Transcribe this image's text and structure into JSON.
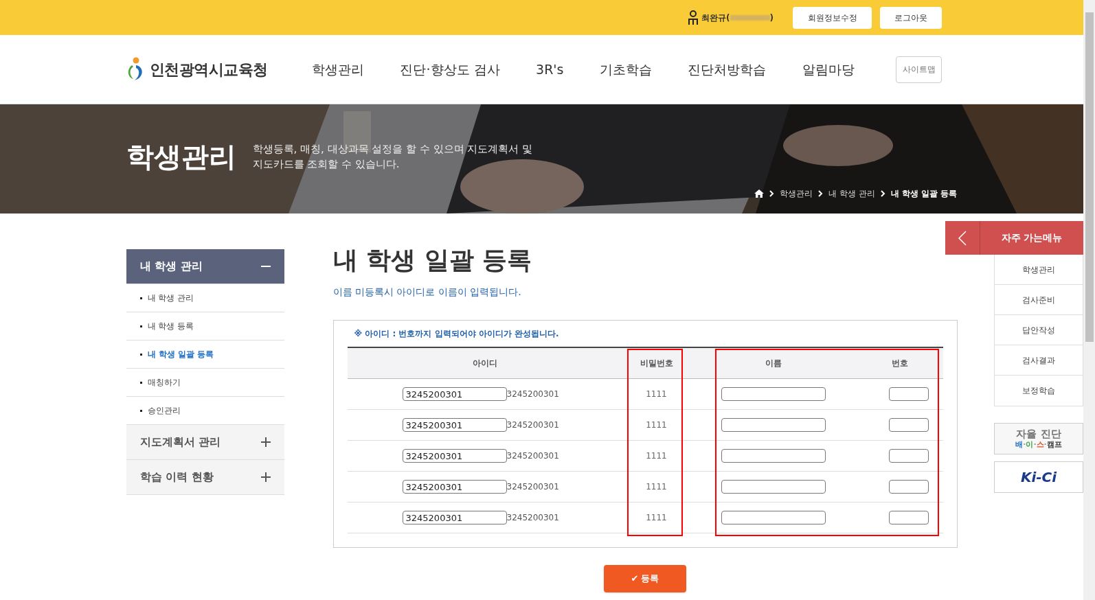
{
  "top_bar": {
    "user_name": "최완규(",
    "user_suffix": ")",
    "buttons": [
      "회원정보수정",
      "로그아웃"
    ]
  },
  "header": {
    "logo_text": "인천광역시교육청",
    "nav": [
      "학생관리",
      "진단·향상도 검사",
      "3R's",
      "기초학습",
      "진단처방학습",
      "알림마당"
    ],
    "sitemap": "사이트맵"
  },
  "banner": {
    "title": "학생관리",
    "description": "학생등록, 매칭, 대상과목 설정을 할 수 있으며 지도계획서 및\n지도카드를 조회할 수 있습니다.",
    "breadcrumb": [
      "학생관리",
      "내 학생 관리",
      "내 학생 일괄 등록"
    ]
  },
  "sidebar": {
    "groups": [
      {
        "label": "내 학생 관리",
        "expanded": true,
        "children": [
          {
            "label": "내 학생 관리",
            "selected": false
          },
          {
            "label": "내 학생 등록",
            "selected": false
          },
          {
            "label": "내 학생 일괄 등록",
            "selected": true
          },
          {
            "label": "매칭하기",
            "selected": false
          },
          {
            "label": "승인관리",
            "selected": false
          }
        ]
      },
      {
        "label": "지도계획서 관리",
        "expanded": false
      },
      {
        "label": "학습 이력 현황",
        "expanded": false
      }
    ]
  },
  "page": {
    "title": "내 학생 일괄 등록",
    "subtitle": "이름 미등록시 아이디로 이름이 입력됩니다.",
    "notice": "※ 아이디 : 번호까지 입력되어야 아이디가 완성됩니다."
  },
  "table": {
    "columns": [
      "아이디",
      "비밀번호",
      "이름",
      "번호"
    ],
    "rows": [
      {
        "id_value": "3245200301",
        "id_text": "3245200301",
        "password": "1111"
      },
      {
        "id_value": "3245200301",
        "id_text": "3245200301",
        "password": "1111"
      },
      {
        "id_value": "3245200301",
        "id_text": "3245200301",
        "password": "1111"
      },
      {
        "id_value": "3245200301",
        "id_text": "3245200301",
        "password": "1111"
      },
      {
        "id_value": "3245200301",
        "id_text": "3245200301",
        "password": "1111"
      }
    ]
  },
  "submit_button": {
    "icon": "✔",
    "label": "등록"
  },
  "quick_menu": {
    "title": "자주 가는메뉴",
    "items": [
      "학생관리",
      "검사준비",
      "답안작성",
      "검사결과",
      "보정학습"
    ],
    "banners": [
      {
        "kind": "diagnosis",
        "title": "자율 진단",
        "parts": [
          "배",
          "·",
          "이",
          "·",
          "스",
          "·",
          "캠프"
        ]
      },
      {
        "kind": "kici",
        "title": "Ki-Ci"
      }
    ]
  }
}
